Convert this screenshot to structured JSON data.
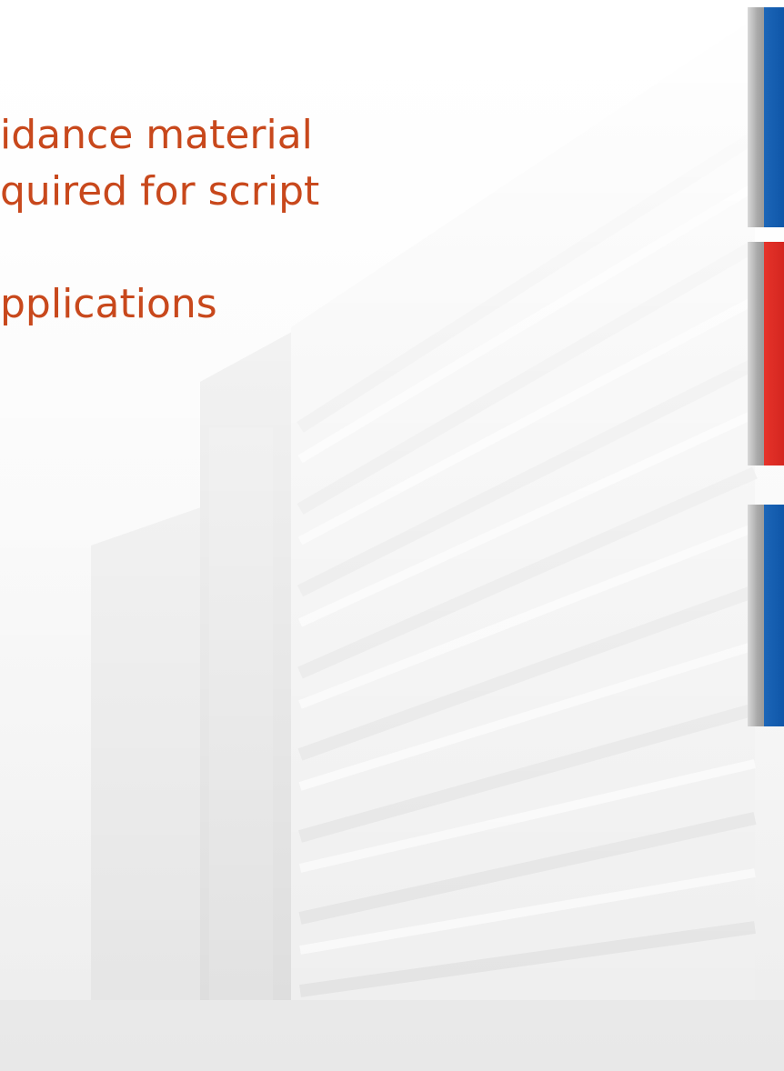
{
  "text": {
    "lines": [
      "idance material",
      "quired for script",
      "",
      "pplications"
    ]
  },
  "colors": {
    "text": "#c8481c",
    "bar_blue": "#0f56a8",
    "bar_red": "#e6332a",
    "bar_shadow": "#a9a9a9"
  }
}
